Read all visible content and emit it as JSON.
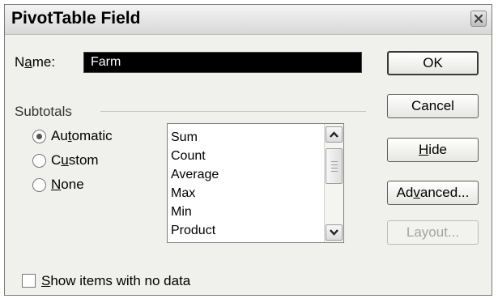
{
  "window": {
    "title": "PivotTable Field"
  },
  "name_field": {
    "label_pre": "N",
    "label_mnemonic": "a",
    "label_post": "me:",
    "value": "Farm"
  },
  "subtotals": {
    "group_label": "Subtotals",
    "options": [
      {
        "pre": "Au",
        "mnemonic": "t",
        "post": "omatic",
        "selected": true
      },
      {
        "pre": "C",
        "mnemonic": "u",
        "post": "stom",
        "selected": false
      },
      {
        "pre": "",
        "mnemonic": "N",
        "post": "one",
        "selected": false
      }
    ],
    "functions": [
      "Sum",
      "Count",
      "Average",
      "Max",
      "Min",
      "Product"
    ]
  },
  "buttons": {
    "ok": "OK",
    "cancel": "Cancel",
    "hide_mnemonic": "H",
    "hide_post": "ide",
    "advanced_pre": "Ad",
    "advanced_mnemonic": "v",
    "advanced_post": "anced...",
    "layout": "Layout..."
  },
  "show_items": {
    "mnemonic": "S",
    "post": "how items with no data",
    "checked": false
  },
  "icons": {
    "close": "close-icon",
    "scroll_up": "chevron-up-icon",
    "scroll_down": "chevron-down-icon"
  }
}
